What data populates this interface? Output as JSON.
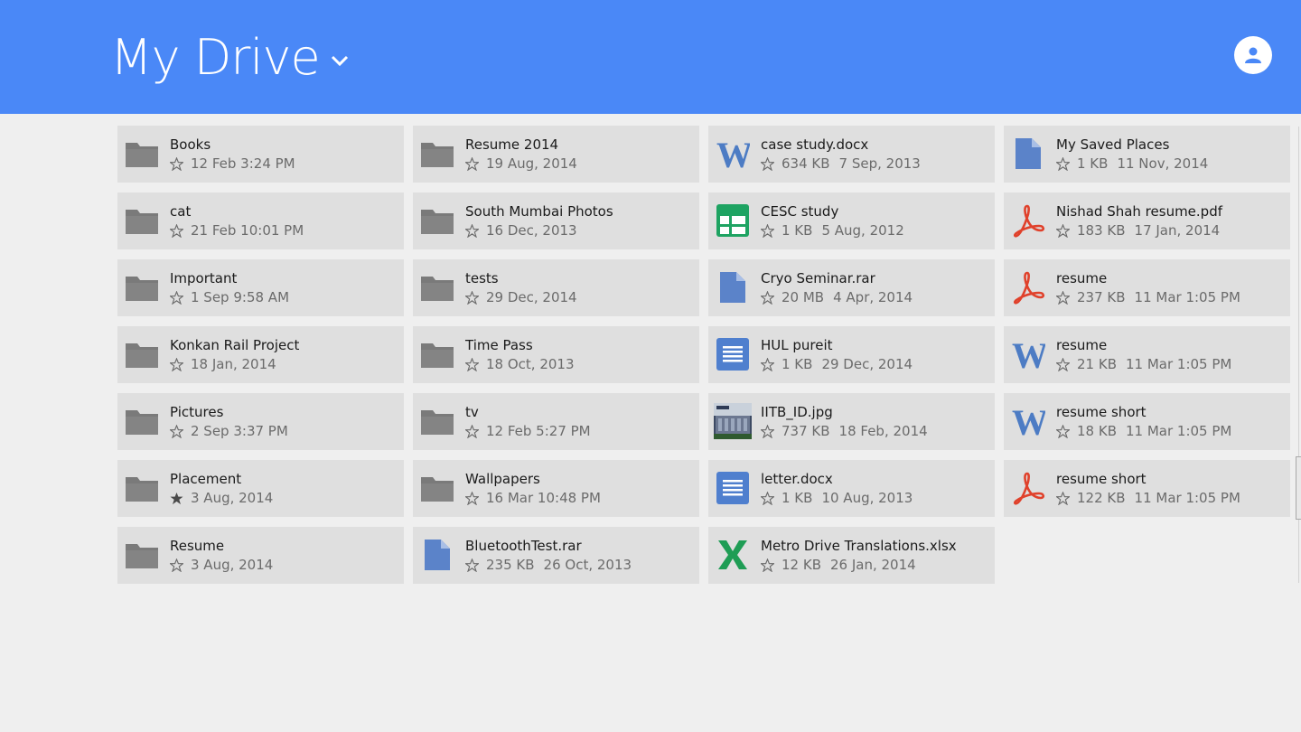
{
  "header": {
    "title": "My Drive",
    "accent": "#4a88f7",
    "avatar_icon": "user-avatar-icon",
    "chevron_icon": "chevron-down-icon"
  },
  "files": [
    {
      "name": "Books",
      "type": "folder",
      "starred": false,
      "size": "",
      "date": "12 Feb 3:24 PM"
    },
    {
      "name": "cat",
      "type": "folder",
      "starred": false,
      "size": "",
      "date": "21 Feb 10:01 PM"
    },
    {
      "name": "Important",
      "type": "folder",
      "starred": false,
      "size": "",
      "date": "1 Sep 9:58 AM"
    },
    {
      "name": "Konkan Rail Project",
      "type": "folder",
      "starred": false,
      "size": "",
      "date": "18 Jan, 2014"
    },
    {
      "name": "Pictures",
      "type": "folder",
      "starred": false,
      "size": "",
      "date": "2 Sep 3:37 PM"
    },
    {
      "name": "Placement",
      "type": "folder",
      "starred": true,
      "size": "",
      "date": "3 Aug, 2014"
    },
    {
      "name": "Resume",
      "type": "folder",
      "starred": false,
      "size": "",
      "date": "3 Aug, 2014"
    },
    {
      "name": "Resume 2014",
      "type": "folder",
      "starred": false,
      "size": "",
      "date": "19 Aug, 2014"
    },
    {
      "name": "South Mumbai Photos",
      "type": "folder",
      "starred": false,
      "size": "",
      "date": "16 Dec, 2013"
    },
    {
      "name": "tests",
      "type": "folder",
      "starred": false,
      "size": "",
      "date": "29 Dec, 2014"
    },
    {
      "name": "Time Pass",
      "type": "folder",
      "starred": false,
      "size": "",
      "date": "18 Oct, 2013"
    },
    {
      "name": "tv",
      "type": "folder",
      "starred": false,
      "size": "",
      "date": "12 Feb 5:27 PM"
    },
    {
      "name": "Wallpapers",
      "type": "folder",
      "starred": false,
      "size": "",
      "date": "16 Mar 10:48 PM"
    },
    {
      "name": "BluetoothTest.rar",
      "type": "file",
      "starred": false,
      "size": "235 KB",
      "date": "26 Oct, 2013"
    },
    {
      "name": "case study.docx",
      "type": "word",
      "starred": false,
      "size": "634 KB",
      "date": "7 Sep, 2013"
    },
    {
      "name": "CESC study",
      "type": "sheet",
      "starred": false,
      "size": "1 KB",
      "date": "5 Aug, 2012"
    },
    {
      "name": "Cryo Seminar.rar",
      "type": "file",
      "starred": false,
      "size": "20 MB",
      "date": "4 Apr, 2014"
    },
    {
      "name": "HUL pureit",
      "type": "doc",
      "starred": false,
      "size": "1 KB",
      "date": "29 Dec, 2014"
    },
    {
      "name": "IITB_ID.jpg",
      "type": "image",
      "starred": false,
      "size": "737 KB",
      "date": "18 Feb, 2014"
    },
    {
      "name": "letter.docx",
      "type": "doc",
      "starred": false,
      "size": "1 KB",
      "date": "10 Aug, 2013"
    },
    {
      "name": "Metro Drive Translations.xlsx",
      "type": "excel",
      "starred": false,
      "size": "12 KB",
      "date": "26 Jan, 2014"
    },
    {
      "name": "My Saved Places",
      "type": "file",
      "starred": false,
      "size": "1 KB",
      "date": "11 Nov, 2014"
    },
    {
      "name": "Nishad Shah resume.pdf",
      "type": "pdf",
      "starred": false,
      "size": "183 KB",
      "date": "17 Jan, 2014"
    },
    {
      "name": "resume",
      "type": "pdf",
      "starred": false,
      "size": "237 KB",
      "date": "11 Mar 1:05 PM"
    },
    {
      "name": "resume",
      "type": "word",
      "starred": false,
      "size": "21 KB",
      "date": "11 Mar 1:05 PM"
    },
    {
      "name": "resume short",
      "type": "word",
      "starred": false,
      "size": "18 KB",
      "date": "11 Mar 1:05 PM"
    },
    {
      "name": "resume short",
      "type": "pdf",
      "starred": false,
      "size": "122 KB",
      "date": "11 Mar 1:05 PM"
    }
  ]
}
